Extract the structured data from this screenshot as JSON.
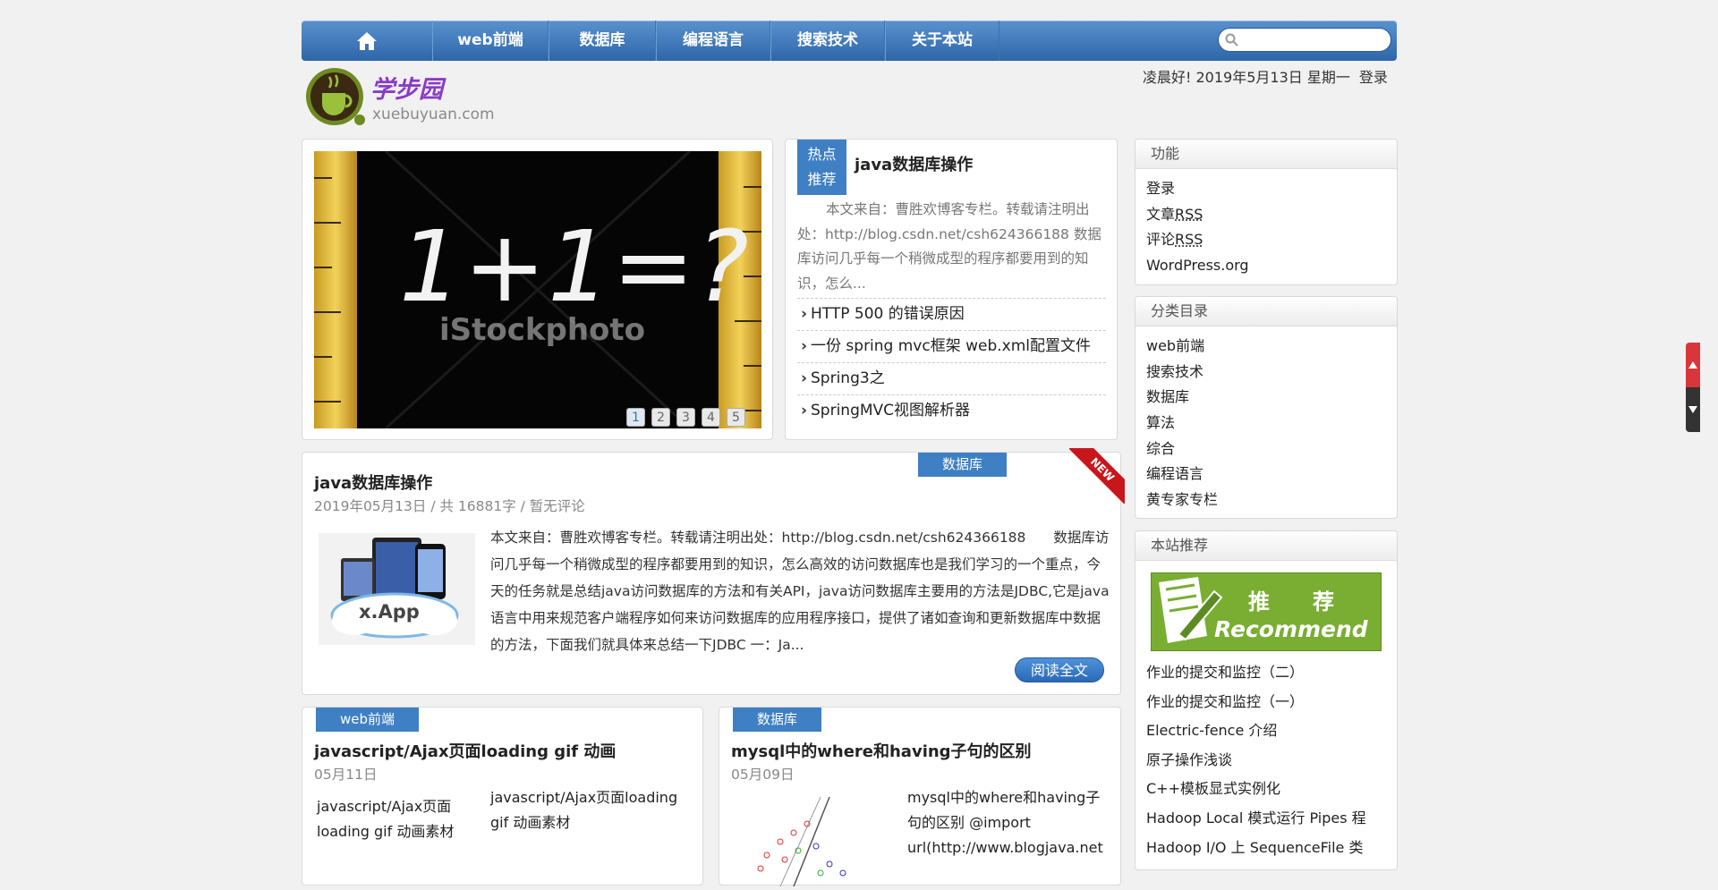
{
  "nav": {
    "items": [
      "web前端",
      "数据库",
      "编程语言",
      "搜索技术",
      "关于本站"
    ],
    "search_placeholder": ""
  },
  "header": {
    "logo_text": "学步园",
    "logo_sub": "xuebuyuan.com",
    "greeting": "凌晨好! 2019年5月13日 星期一",
    "login": "登录"
  },
  "slider": {
    "image_text": "1+1=?",
    "watermark": "iStockphoto",
    "pages": [
      "1",
      "2",
      "3",
      "4",
      "5"
    ],
    "active_page": 1
  },
  "hot": {
    "tag_line1": "热点",
    "tag_line2": "推荐",
    "title": "java数据库操作",
    "excerpt": "本文来自：曹胜欢博客专栏。转载请注明出处：http://blog.csdn.net/csh624366188 数据库访问几乎每一个稍微成型的程序都要用到的知识，怎么...",
    "links": [
      "HTTP 500 的错误原因",
      "一份 spring mvc框架 web.xml配置文件",
      "Spring3之",
      "SpringMVC视图解析器"
    ]
  },
  "featured": {
    "category": "数据库",
    "ribbon": "NEW",
    "title": "java数据库操作",
    "meta": "2019年05月13日 / 共 16881字 / 暂无评论",
    "thumb_label": "x.App",
    "text": "本文来自：曹胜欢博客专栏。转载请注明出处：http://blog.csdn.net/csh624366188　　数据库访问几乎每一个稍微成型的程序都要用到的知识，怎么高效的访问数据库也是我们学习的一个重点，今天的任务就是总结java访问数据库的方法和有关API，java访问数据库主要用的方法是JDBC,它是java语言中用来规范客户端程序如何来访问数据库的应用程序接口，提供了诸如查询和更新数据库中数据的方法，下面我们就具体来总结一下JDBC 一：Ja...",
    "read_more": "阅读全文"
  },
  "posts": [
    {
      "category": "web前端",
      "title": "javascript/Ajax页面loading gif 动画",
      "date": "05月11日",
      "image_alt": "javascript/Ajax页面loading gif 动画素材",
      "text": "javascript/Ajax页面loading gif 动画素材"
    },
    {
      "category": "数据库",
      "title": "mysql中的where和having子句的区别",
      "date": "05月09日",
      "text": "mysql中的where和having子句的区别 @import url(http://www.blogjava.net"
    }
  ],
  "sidebar": {
    "func": {
      "title": "功能",
      "items": [
        {
          "pre": "登录",
          "link": ""
        },
        {
          "pre": "文章",
          "link": "RSS"
        },
        {
          "pre": "评论",
          "link": "RSS"
        },
        {
          "pre": "WordPress.org",
          "link": ""
        }
      ]
    },
    "categories": {
      "title": "分类目录",
      "items": [
        "web前端",
        "搜索技术",
        "数据库",
        "算法",
        "综合",
        "编程语言",
        "黄专家专栏"
      ]
    },
    "recommend": {
      "title": "本站推荐",
      "banner_cn": "推　　荐",
      "banner_en": "Recommend",
      "items": [
        "作业的提交和监控（二）",
        "作业的提交和监控（一）",
        "Electric-fence 介绍",
        "原子操作浅谈",
        "C++模板显式实例化",
        "Hadoop Local 模式运行 Pipes 程",
        "Hadoop I/O 上 SequenceFile 类"
      ]
    }
  },
  "colors": {
    "nav_blue": "#2e66a8",
    "tag_blue": "#3f7fc4",
    "ribbon_red": "#c9151c",
    "banner_green": "#79ae32"
  }
}
